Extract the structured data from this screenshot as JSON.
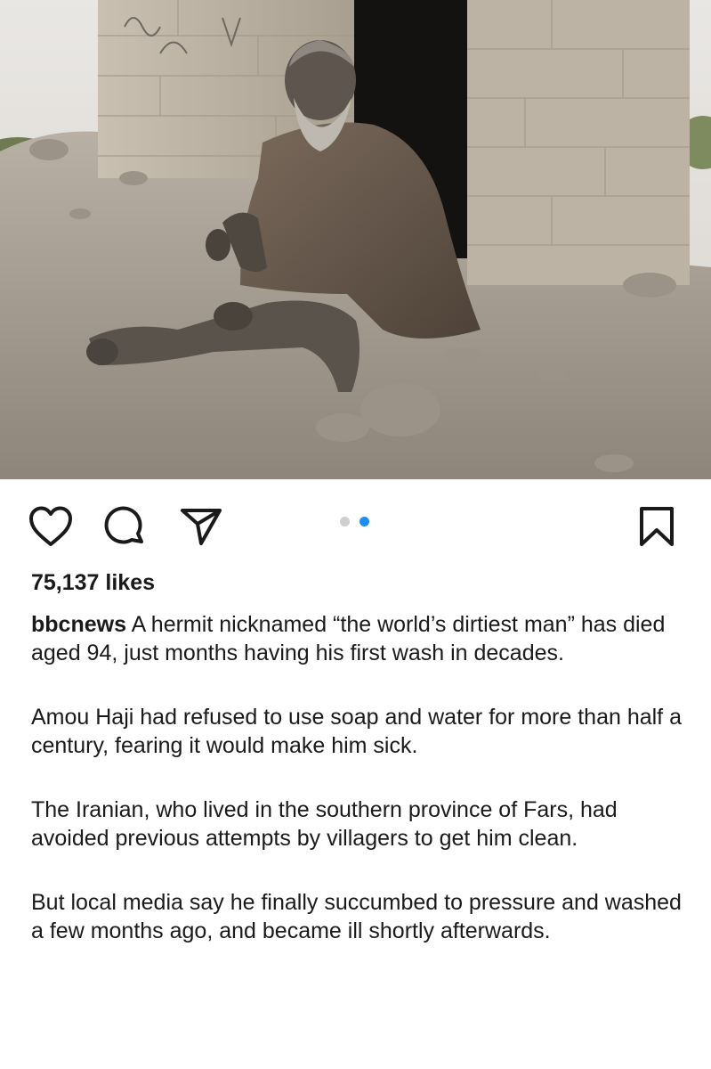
{
  "post": {
    "image_alt": "Elderly man sitting cross-legged on rubble outside a brick hut",
    "carousel": {
      "total": 2,
      "active": 2
    },
    "likes": "75,137 likes",
    "username": "bbcnews",
    "caption_paragraphs": [
      "A hermit nicknamed “the world’s dirtiest man” has died aged 94, just months having his first wash in decades.",
      "Amou Haji had refused to use soap and water for more than half a century, fearing it would make him sick.",
      "The Iranian, who lived in the southern province of Fars, had avoided previous attempts by villagers to get him clean.",
      "But local media say he finally succumbed to pressure and washed a few months ago, and became ill shortly afterwards."
    ]
  },
  "icons": {
    "like": "heart-icon",
    "comment": "comment-bubble-icon",
    "share": "paper-plane-icon",
    "save": "bookmark-icon"
  },
  "colors": {
    "text": "#1a1a1a",
    "carousel_active": "#1f8ef1",
    "carousel_inactive": "#cfcfcf",
    "background": "#ffffff"
  }
}
